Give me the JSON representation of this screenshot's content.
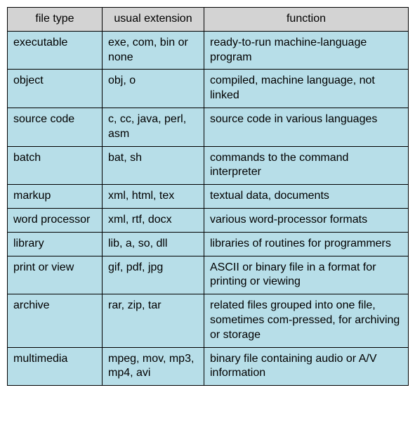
{
  "table": {
    "headers": [
      "file type",
      "usual extension",
      "function"
    ],
    "rows": [
      {
        "type": "executable",
        "ext": "exe, com, bin or none",
        "func": "ready-to-run machine-language program"
      },
      {
        "type": "object",
        "ext": "obj, o",
        "func": "compiled, machine language, not linked"
      },
      {
        "type": "source code",
        "ext": "c, cc, java, perl, asm",
        "func": "source code in various languages"
      },
      {
        "type": "batch",
        "ext": "bat, sh",
        "func": "commands to the command interpreter"
      },
      {
        "type": "markup",
        "ext": "xml, html, tex",
        "func": "textual data, documents"
      },
      {
        "type": "word processor",
        "ext": "xml, rtf, docx",
        "func": "various word-processor formats"
      },
      {
        "type": "library",
        "ext": "lib, a, so, dll",
        "func": "libraries of routines for programmers"
      },
      {
        "type": "print or view",
        "ext": "gif, pdf, jpg",
        "func": "ASCII or binary file in a format for printing or viewing"
      },
      {
        "type": "archive",
        "ext": "rar, zip, tar",
        "func": "related files grouped into one file, sometimes com-pressed, for archiving or storage"
      },
      {
        "type": "multimedia",
        "ext": "mpeg, mov, mp3, mp4, avi",
        "func": "binary file containing audio or A/V information"
      }
    ]
  }
}
